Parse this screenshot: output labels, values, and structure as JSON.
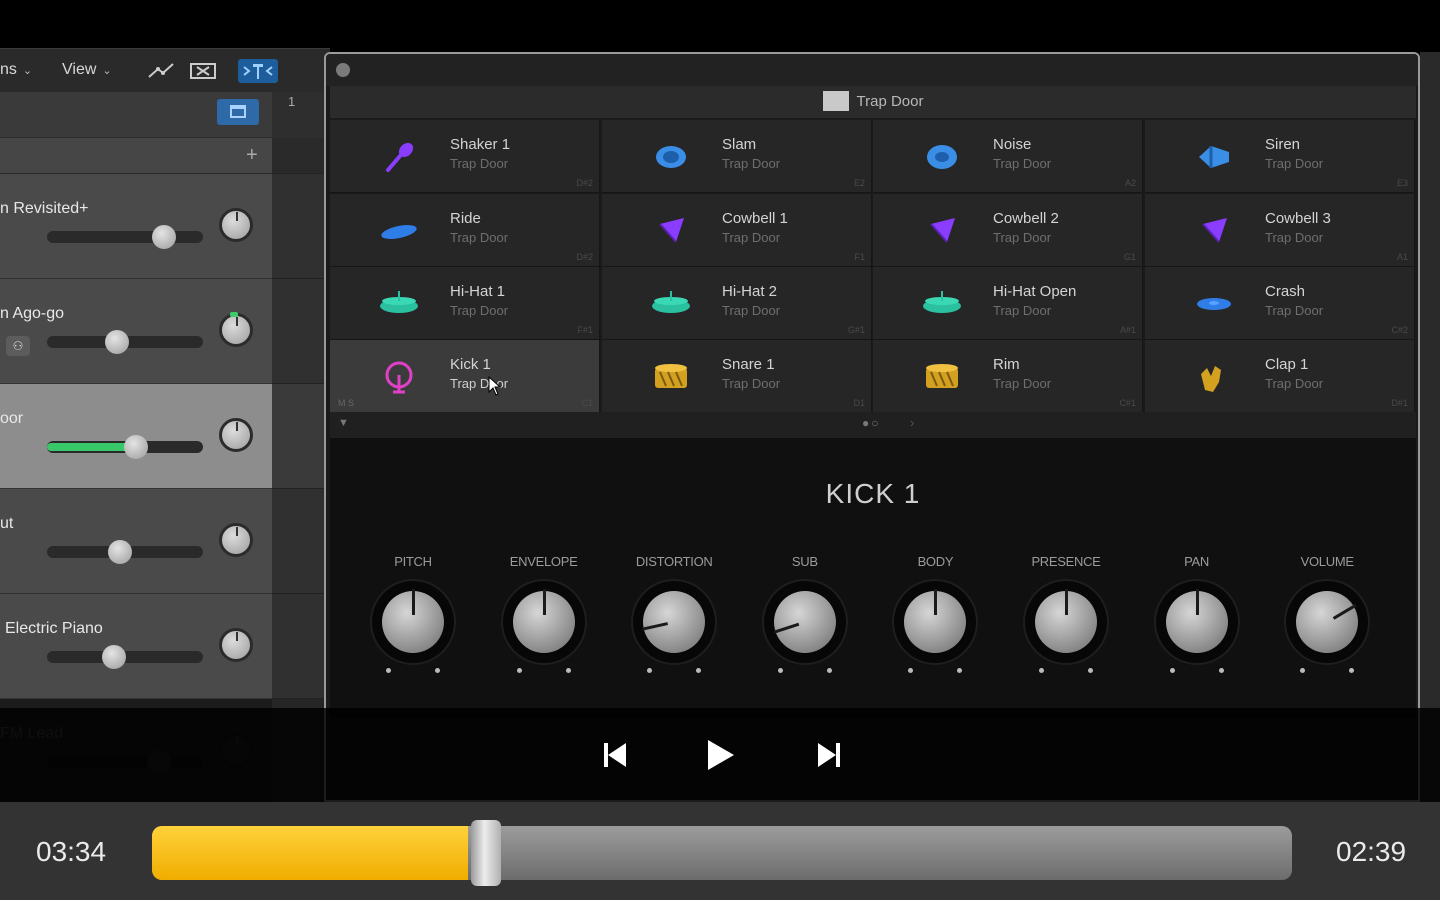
{
  "toolbar": {
    "functions_label": "ns",
    "view_label": "View",
    "chevron": "⌄"
  },
  "tracks": [
    {
      "name": "n Revisited+",
      "volume": 0.75,
      "pan_knob": "pan"
    },
    {
      "name": "n Ago-go",
      "volume": 0.45,
      "pan_knob": "pan"
    },
    {
      "name": "oor",
      "volume": 0.57,
      "pan_knob": "pan"
    },
    {
      "name": "ut",
      "volume": 0.47,
      "pan_knob": "pan"
    },
    {
      "name": "Electric Piano",
      "volume": 0.43,
      "pan_knob": "pan"
    },
    {
      "name": "FM Lead",
      "volume": 0.72,
      "pan_knob": "pan"
    }
  ],
  "arrange": {
    "bar_number": "1"
  },
  "drum_kit": {
    "title": "Trap Door",
    "pads": [
      {
        "name": "Shaker 1",
        "kit": "Trap Door",
        "note": "D#2",
        "icon": "shaker-icon",
        "color": "#8a3cff"
      },
      {
        "name": "Slam",
        "kit": "Trap Door",
        "note": "E2",
        "icon": "slam-icon",
        "color": "#3a8ee6"
      },
      {
        "name": "Noise",
        "kit": "Trap Door",
        "note": "A2",
        "icon": "noise-icon",
        "color": "#3a8ee6"
      },
      {
        "name": "Siren",
        "kit": "Trap Door",
        "note": "E3",
        "icon": "siren-icon",
        "color": "#3a8ee6"
      },
      {
        "name": "Ride",
        "kit": "Trap Door",
        "note": "D#2",
        "icon": "ride-icon",
        "color": "#2f7ee8"
      },
      {
        "name": "Cowbell 1",
        "kit": "Trap Door",
        "note": "F1",
        "icon": "cowbell-icon",
        "color": "#8a3cff"
      },
      {
        "name": "Cowbell 2",
        "kit": "Trap Door",
        "note": "G1",
        "icon": "cowbell-icon",
        "color": "#8a3cff"
      },
      {
        "name": "Cowbell 3",
        "kit": "Trap Door",
        "note": "A1",
        "icon": "cowbell-icon",
        "color": "#8a3cff"
      },
      {
        "name": "Hi-Hat 1",
        "kit": "Trap Door",
        "note": "F#1",
        "icon": "hihat-icon",
        "color": "#2ac0a0"
      },
      {
        "name": "Hi-Hat 2",
        "kit": "Trap Door",
        "note": "G#1",
        "icon": "hihat-icon",
        "color": "#2ac0a0"
      },
      {
        "name": "Hi-Hat Open",
        "kit": "Trap Door",
        "note": "A#1",
        "icon": "hihat-icon",
        "color": "#2ac0a0"
      },
      {
        "name": "Crash",
        "kit": "Trap Door",
        "note": "C#2",
        "icon": "crash-icon",
        "color": "#2f7ee8"
      },
      {
        "name": "Kick 1",
        "kit": "Trap Door",
        "note": "C1",
        "icon": "kick-icon",
        "color": "#e040c8"
      },
      {
        "name": "Snare 1",
        "kit": "Trap Door",
        "note": "D1",
        "icon": "snare-icon",
        "color": "#d4a020"
      },
      {
        "name": "Rim",
        "kit": "Trap Door",
        "note": "C#1",
        "icon": "snare-icon",
        "color": "#d4a020"
      },
      {
        "name": "Clap 1",
        "kit": "Trap Door",
        "note": "D#1",
        "icon": "clap-icon",
        "color": "#d4a020"
      }
    ],
    "kick_pad_labels": "M  S"
  },
  "editor": {
    "title": "KICK 1",
    "params": [
      {
        "label": "PITCH",
        "value": 0.5
      },
      {
        "label": "ENVELOPE",
        "value": 0.5
      },
      {
        "label": "DISTORTION",
        "value": 0.12
      },
      {
        "label": "SUB",
        "value": 0.1
      },
      {
        "label": "BODY",
        "value": 0.5
      },
      {
        "label": "PRESENCE",
        "value": 0.5
      },
      {
        "label": "PAN",
        "value": 0.5
      },
      {
        "label": "VOLUME",
        "value": 0.72
      }
    ]
  },
  "transport": {
    "prev_icon": "skip-back-icon",
    "play_icon": "play-icon",
    "next_icon": "skip-forward-icon"
  },
  "playback": {
    "elapsed": "03:34",
    "remaining": "02:39",
    "progress": 0.277
  },
  "colors": {
    "progress": "#f5b800",
    "selected_track": "#8d8d8d",
    "volume_fill": "#38c86a",
    "toolbar_active": "#1d5d9b"
  }
}
